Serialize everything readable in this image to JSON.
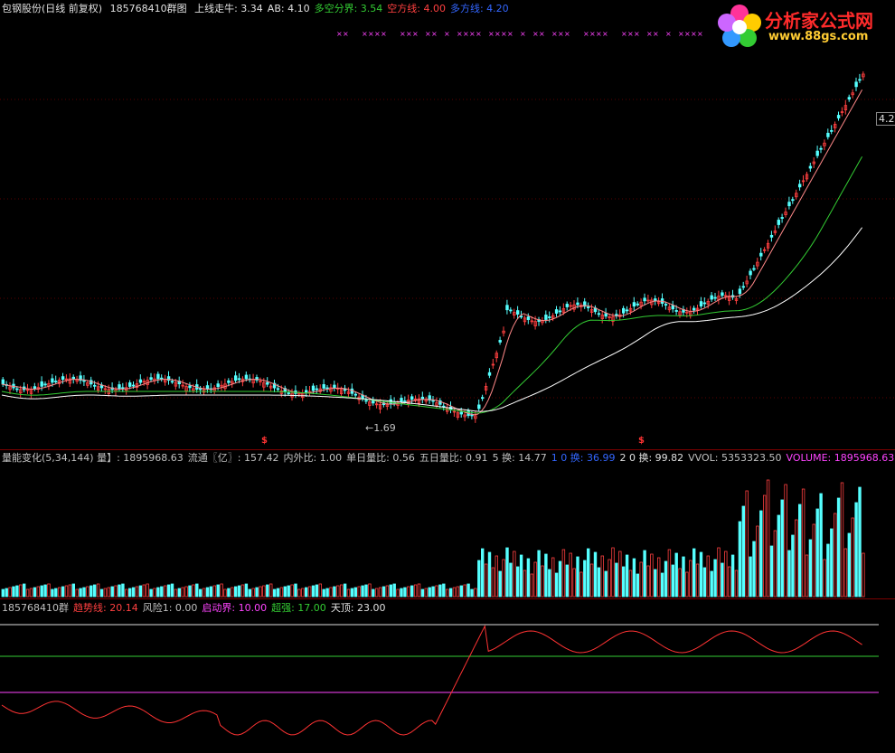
{
  "main_header": {
    "stock": "包钢股份(日线 前复权)",
    "qty": "185768410群图",
    "items": [
      {
        "label": "上线走牛: 3.34",
        "color": "#e0e0e0"
      },
      {
        "label": "AB: 4.10",
        "color": "#e0e0e0"
      },
      {
        "label": "多空分界: 3.54",
        "color": "#33cc33"
      },
      {
        "label": "空方线: 4.00",
        "color": "#ff4040"
      },
      {
        "label": "多方线: 4.20",
        "color": "#3366ff"
      }
    ]
  },
  "vol_header": {
    "items": [
      {
        "label": "量能变化(5,34,144)  量】: 1895968.63",
        "color": "#c0c0c0"
      },
      {
        "label": "流通〖亿〗: 157.42",
        "color": "#c0c0c0"
      },
      {
        "label": "内外比: 1.00",
        "color": "#c0c0c0"
      },
      {
        "label": "单日量比: 0.56",
        "color": "#c0c0c0"
      },
      {
        "label": "五日量比: 0.91",
        "color": "#c0c0c0"
      },
      {
        "label": "5 换: 14.77",
        "color": "#c0c0c0"
      },
      {
        "label": "1 0 换: 36.99",
        "color": "#3366ff"
      },
      {
        "label": "2 0 换: 99.82",
        "color": "#e0e0e0"
      },
      {
        "label": "VVOL: 5353323.50",
        "color": "#c0c0c0"
      },
      {
        "label": "VOLUME: 1895968.63",
        "color": "#ff44ff"
      }
    ]
  },
  "ind_header": {
    "items": [
      {
        "label": "185768410群",
        "color": "#c0c0c0"
      },
      {
        "label": "趋势线: 20.14",
        "color": "#ff4040"
      },
      {
        "label": "风险1: 0.00",
        "color": "#c0c0c0"
      },
      {
        "label": "启动界: 10.00",
        "color": "#ff44ff"
      },
      {
        "label": "超强: 17.00",
        "color": "#33cc33"
      },
      {
        "label": "天顶: 23.00",
        "color": "#e0e0e0"
      }
    ]
  },
  "logo": {
    "title": "分析家公式网",
    "url": "www.88gs.com"
  },
  "price_tag": "4.2",
  "low_label": "←1.69",
  "signal_marks": [
    "$",
    "$"
  ],
  "colors": {
    "up": "#ff4040",
    "down": "#55ffff",
    "ma_short": "#ff8888",
    "ma_mid": "#33cc33",
    "ma_long": "#ffffff",
    "divider": "#7a0000"
  }
}
